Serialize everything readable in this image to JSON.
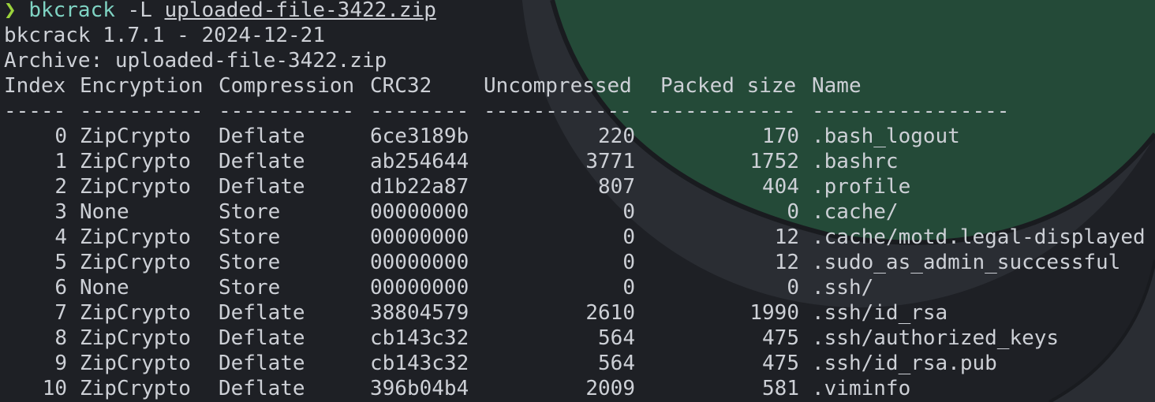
{
  "terminal": {
    "prompt_symbol": "❯",
    "command": {
      "program": "bkcrack",
      "flag": "-L",
      "file": "uploaded-file-3422.zip"
    },
    "version_line": "bkcrack 1.7.1 - 2024-12-21",
    "archive_line": "Archive: uploaded-file-3422.zip",
    "table": {
      "headers": [
        "Index",
        "Encryption",
        "Compression",
        "CRC32",
        "Uncompressed",
        "Packed size",
        "Name"
      ],
      "separators": [
        "-----",
        "----------",
        "-----------",
        "--------",
        "------------",
        "------------",
        "----------------"
      ],
      "rows": [
        {
          "index": "0",
          "encryption": "ZipCrypto",
          "compression": "Deflate",
          "crc32": "6ce3189b",
          "uncompressed": "220",
          "packed": "170",
          "name": ".bash_logout"
        },
        {
          "index": "1",
          "encryption": "ZipCrypto",
          "compression": "Deflate",
          "crc32": "ab254644",
          "uncompressed": "3771",
          "packed": "1752",
          "name": ".bashrc"
        },
        {
          "index": "2",
          "encryption": "ZipCrypto",
          "compression": "Deflate",
          "crc32": "d1b22a87",
          "uncompressed": "807",
          "packed": "404",
          "name": ".profile"
        },
        {
          "index": "3",
          "encryption": "None",
          "compression": "Store",
          "crc32": "00000000",
          "uncompressed": "0",
          "packed": "0",
          "name": ".cache/"
        },
        {
          "index": "4",
          "encryption": "ZipCrypto",
          "compression": "Store",
          "crc32": "00000000",
          "uncompressed": "0",
          "packed": "12",
          "name": ".cache/motd.legal-displayed"
        },
        {
          "index": "5",
          "encryption": "ZipCrypto",
          "compression": "Store",
          "crc32": "00000000",
          "uncompressed": "0",
          "packed": "12",
          "name": ".sudo_as_admin_successful"
        },
        {
          "index": "6",
          "encryption": "None",
          "compression": "Store",
          "crc32": "00000000",
          "uncompressed": "0",
          "packed": "0",
          "name": ".ssh/"
        },
        {
          "index": "7",
          "encryption": "ZipCrypto",
          "compression": "Deflate",
          "crc32": "38804579",
          "uncompressed": "2610",
          "packed": "1990",
          "name": ".ssh/id_rsa"
        },
        {
          "index": "8",
          "encryption": "ZipCrypto",
          "compression": "Deflate",
          "crc32": "cb143c32",
          "uncompressed": "564",
          "packed": "475",
          "name": ".ssh/authorized_keys"
        },
        {
          "index": "9",
          "encryption": "ZipCrypto",
          "compression": "Deflate",
          "crc32": "cb143c32",
          "uncompressed": "564",
          "packed": "475",
          "name": ".ssh/id_rsa.pub"
        },
        {
          "index": "10",
          "encryption": "ZipCrypto",
          "compression": "Deflate",
          "crc32": "396b04b4",
          "uncompressed": "2009",
          "packed": "581",
          "name": ".viminfo"
        }
      ]
    }
  },
  "colors": {
    "background": "#1e2025",
    "text": "#cdd0d6",
    "prompt_arrow": "#9bd23c",
    "command": "#7fd3c3",
    "logo_green": "#244a38",
    "logo_dark": "#2a2d33"
  },
  "icons": {
    "background_logo": "circular-green-logo-watermark"
  }
}
